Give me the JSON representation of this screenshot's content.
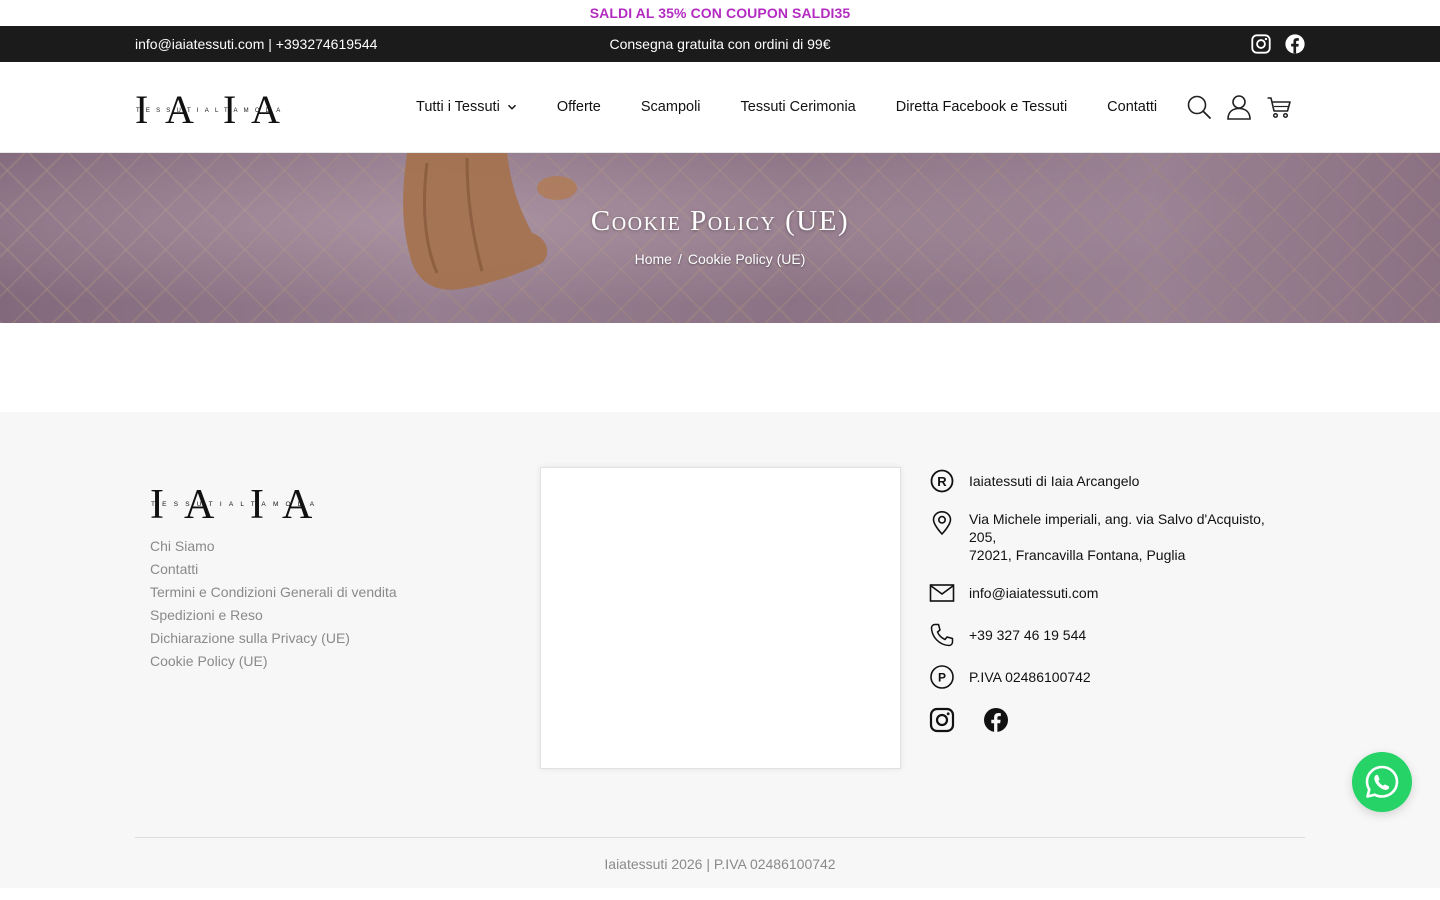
{
  "promo": {
    "text": "SALDI AL 35% CON COUPON SALDI35",
    "color": "#b42bc2"
  },
  "topbar": {
    "contact": "info@iaiatessuti.com | +393274619544",
    "shipping": "Consegna gratuita con ordini di 99€",
    "icons": [
      "instagram-icon",
      "facebook-icon"
    ]
  },
  "header": {
    "logo_text": "IAIA",
    "logo_sub": "TESSUTI ALTA MODA",
    "nav": [
      {
        "label": "Tutti i Tessuti",
        "has_dropdown": true
      },
      {
        "label": "Offerte"
      },
      {
        "label": "Scampoli"
      },
      {
        "label": "Tessuti Cerimonia"
      },
      {
        "label": "Diretta Facebook e Tessuti"
      },
      {
        "label": "Contatti"
      }
    ],
    "icons": [
      "search-icon",
      "user-icon",
      "cart-icon"
    ]
  },
  "hero": {
    "title": "Cookie Policy (UE)",
    "breadcrumb": {
      "home": "Home",
      "separator": "/",
      "current": "Cookie Policy (UE)"
    }
  },
  "footer": {
    "logo_text": "IAIA",
    "logo_sub": "TESSUTI ALTA MODA",
    "links": [
      "Chi Siamo",
      "Contatti",
      "Termini e Condizioni Generali di vendita",
      "Spedizioni e Reso",
      "Dichiarazione sulla Privacy (UE)",
      "Cookie Policy (UE)"
    ],
    "contacts": {
      "company": "Iaiatessuti di Iaia Arcangelo",
      "address_line1": "Via Michele imperiali, ang. via Salvo d'Acquisto, 205,",
      "address_line2": "72021, Francavilla Fontana, Puglia",
      "email": "info@iaiatessuti.com",
      "phone": "+39 327 46 19 544",
      "vat": "P.IVA 02486100742"
    },
    "social": [
      "instagram-icon",
      "facebook-icon"
    ],
    "copyright": "Iaiatessuti 2026 | P.IVA 02486100742"
  },
  "whatsapp": {
    "color": "#25d366"
  }
}
